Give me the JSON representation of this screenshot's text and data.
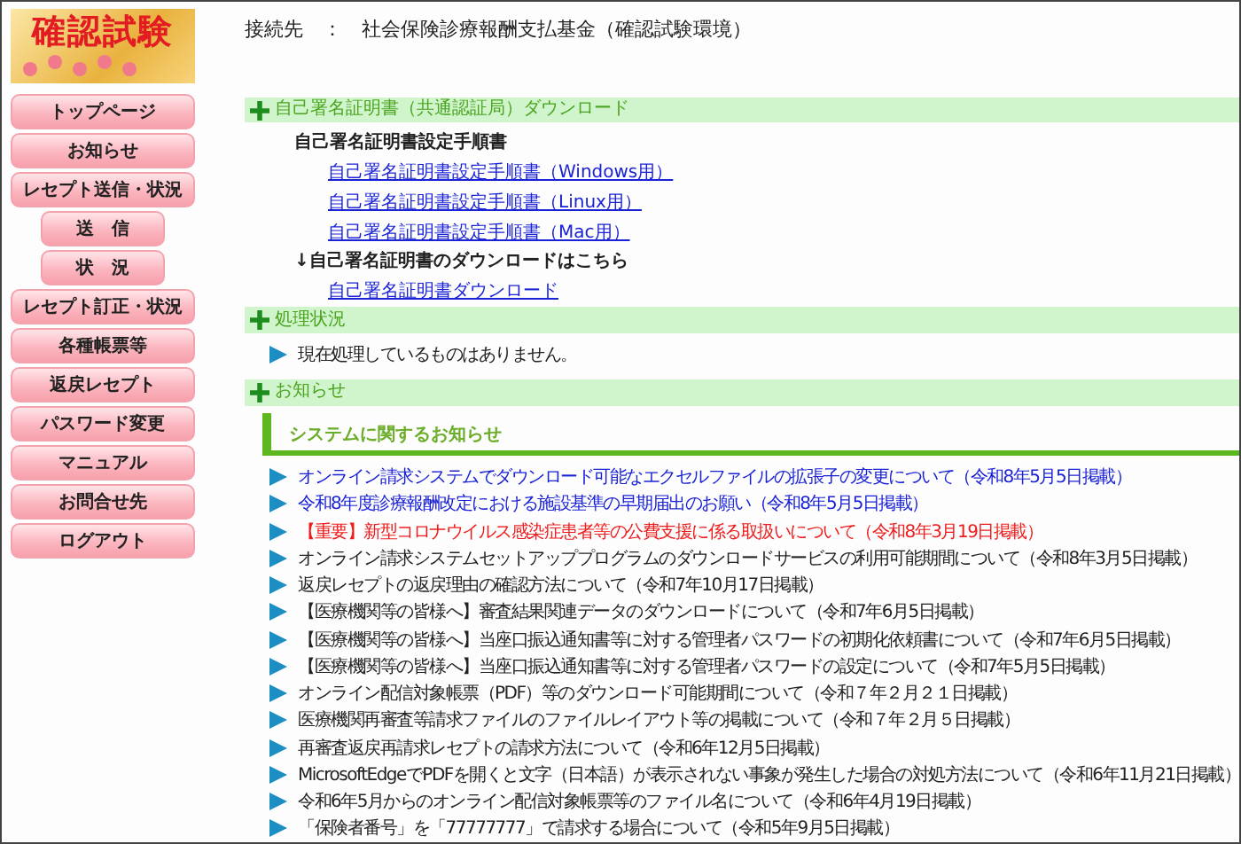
{
  "logo": {
    "text": "確認試験"
  },
  "header": {
    "text": "接続先　：　社会保険診療報酬支払基金（確認試験環境）"
  },
  "nav": [
    {
      "label": "トップページ",
      "kind": "main"
    },
    {
      "label": "お知らせ",
      "kind": "main"
    },
    {
      "label": "レセプト送信・状況",
      "kind": "main"
    },
    {
      "label": "送　信",
      "kind": "sub"
    },
    {
      "label": "状　況",
      "kind": "sub"
    },
    {
      "label": "レセプト訂正・状況",
      "kind": "main"
    },
    {
      "label": "各種帳票等",
      "kind": "main"
    },
    {
      "label": "返戻レセプト",
      "kind": "main"
    },
    {
      "label": "パスワード変更",
      "kind": "main"
    },
    {
      "label": "マニュアル",
      "kind": "main"
    },
    {
      "label": "お問合せ先",
      "kind": "main"
    },
    {
      "label": "ログアウト",
      "kind": "main"
    }
  ],
  "certificate": {
    "title": "自己署名証明書（共通認証局）ダウンロード",
    "setup_heading": "自己署名証明書設定手順書",
    "setup_links": [
      "自己署名証明書設定手順書（Windows用）",
      "自己署名証明書設定手順書（Linux用）",
      "自己署名証明書設定手順書（Mac用）"
    ],
    "download_heading": "↓自己署名証明書のダウンロードはこちら",
    "download_link": "自己署名証明書ダウンロード"
  },
  "processing": {
    "title": "処理状況",
    "message": "現在処理しているものはありません。"
  },
  "notices": {
    "title": "お知らせ",
    "subheading": "システムに関するお知らせ",
    "items": [
      {
        "text": "オンライン請求システムでダウンロード可能なエクセルファイルの拡張子の変更について（令和8年5月5日掲載）",
        "kind": "link"
      },
      {
        "text": "令和8年度診療報酬改定における施設基準の早期届出のお願い（令和8年5月5日掲載）",
        "kind": "link"
      },
      {
        "text": "【重要】新型コロナウイルス感染症患者等の公費支援に係る取扱いについて（令和8年3月19日掲載）",
        "kind": "important"
      },
      {
        "text": "オンライン請求システムセットアッププログラムのダウンロードサービスの利用可能期間について（令和8年3月5日掲載）",
        "kind": "plain"
      },
      {
        "text": "返戻レセプトの返戻理由の確認方法について（令和7年10月17日掲載）",
        "kind": "plain"
      },
      {
        "text": "【医療機関等の皆様へ】審査結果関連データのダウンロードについて（令和7年6月5日掲載）",
        "kind": "plain"
      },
      {
        "text": "【医療機関等の皆様へ】当座口振込通知書等に対する管理者パスワードの初期化依頼書について（令和7年6月5日掲載）",
        "kind": "plain"
      },
      {
        "text": "【医療機関等の皆様へ】当座口振込通知書等に対する管理者パスワードの設定について（令和7年5月5日掲載）",
        "kind": "plain"
      },
      {
        "text": "オンライン配信対象帳票（PDF）等のダウンロード可能期間について（令和７年２月２１日掲載）",
        "kind": "plain"
      },
      {
        "text": "医療機関再審査等請求ファイルのファイルレイアウト等の掲載について（令和７年２月５日掲載）",
        "kind": "plain"
      },
      {
        "text": "再審査返戻再請求レセプトの請求方法について（令和6年12月5日掲載）",
        "kind": "plain"
      },
      {
        "text": "MicrosoftEdgeでPDFを開くと文字（日本語）が表示されない事象が発生した場合の対処方法について（令和6年11月21日掲載）",
        "kind": "plain"
      },
      {
        "text": "令和6年5月からのオンライン配信対象帳票等のファイル名について（令和6年4月19日掲載）",
        "kind": "plain"
      },
      {
        "text": "「保険者番号」を「77777777」で請求する場合について（令和5年9月5日掲載）",
        "kind": "plain"
      }
    ]
  }
}
